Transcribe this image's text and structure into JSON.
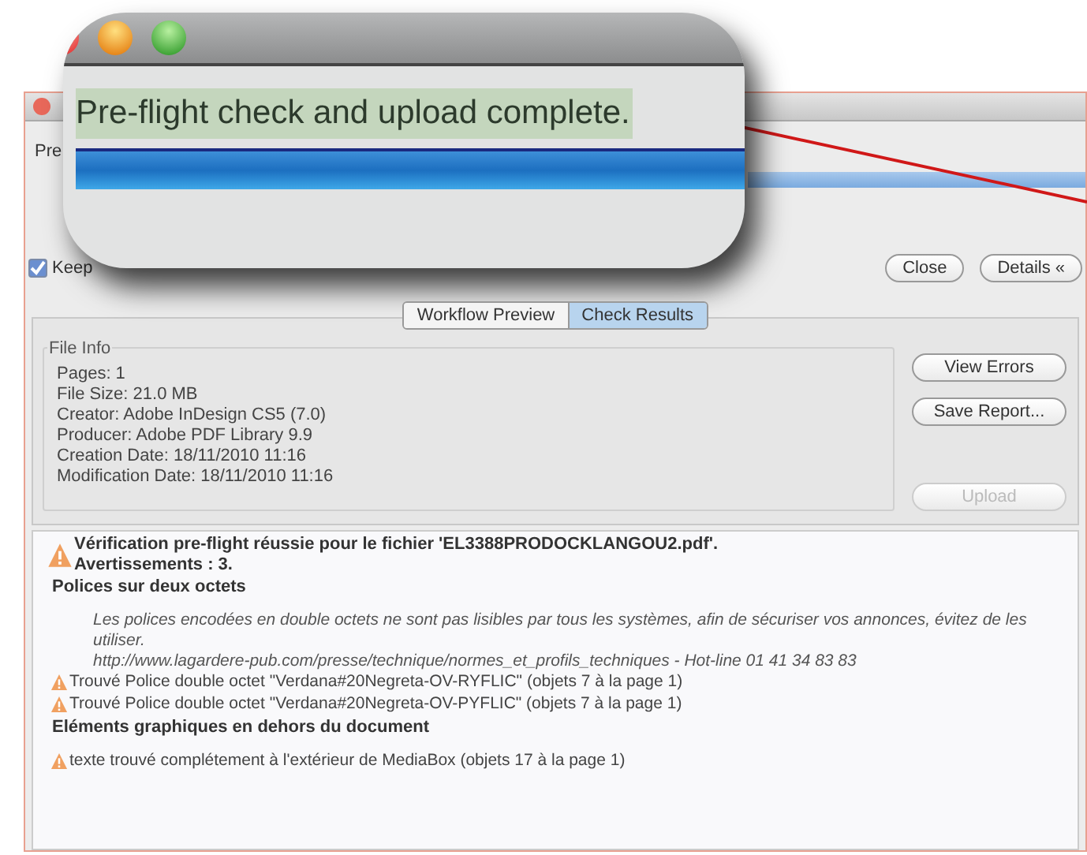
{
  "callout": {
    "status": "Pre-flight check and upload complete.",
    "progress": {
      "level": 1
    }
  },
  "window": {
    "status": "Pre",
    "progress": {
      "level": 1
    }
  },
  "keep_open": {
    "label": "Keep",
    "checked": true
  },
  "buttons": [
    {
      "label": "Close"
    },
    {
      "label": "Details «"
    }
  ],
  "tabs": [
    {
      "label": "Workflow Preview",
      "selected": false
    },
    {
      "label": "Check Results",
      "selected": true
    }
  ],
  "file_info": {
    "title": "File Info",
    "lines": [
      "Pages: 1",
      "File Size: 21.0 MB",
      "Creator: Adobe InDesign CS5 (7.0)",
      "Producer: Adobe PDF Library 9.9",
      "Creation Date: 18/11/2010 11:16",
      "Modification Date: 18/11/2010 11:16"
    ]
  },
  "side_buttons": [
    {
      "label": "View Errors",
      "disabled": false
    },
    {
      "label": "Save Report...",
      "disabled": false
    },
    {
      "label": "Upload",
      "disabled": true
    }
  ],
  "log": [
    {
      "kind": "summary",
      "lines": [
        "Vérification pre-flight réussie pour le fichier 'EL3388PRODOCKLANGOU2.pdf'.",
        "Avertissements : 3."
      ]
    },
    {
      "kind": "heading",
      "text": "Polices sur deux octets"
    },
    {
      "kind": "note",
      "lines": [
        "Les polices encodées en double octets ne sont pas lisibles par tous les systèmes, afin de sécuriser vos annonces, évitez de les utiliser.",
        "http://www.lagardere-pub.com/presse/technique/normes_et_profils_techniques - Hot-line 01 41 34 83 83"
      ]
    },
    {
      "kind": "warning",
      "text": "Trouvé Police double octet \"Verdana#20Negreta-OV-RYFLIC\" (objets 7  à la page 1)"
    },
    {
      "kind": "warning",
      "text": "Trouvé Police double octet \"Verdana#20Negreta-OV-PYFLIC\" (objets 7  à la page 1)"
    },
    {
      "kind": "heading",
      "text": "Eléments graphiques en dehors du document"
    },
    {
      "kind": "warning",
      "text": "texte trouvé complétement à l'extérieur de MediaBox (objets 17  à la page 1)"
    }
  ]
}
